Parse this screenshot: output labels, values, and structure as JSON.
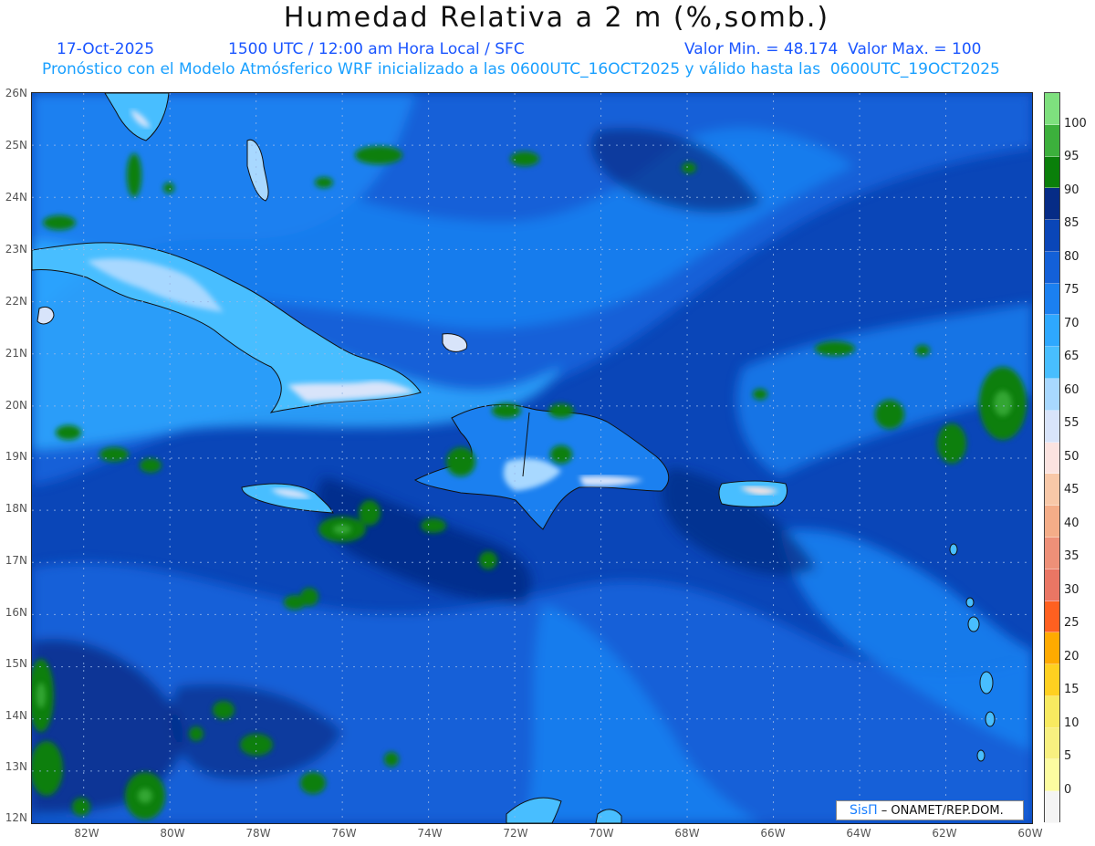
{
  "header": {
    "title": "Humedad Relativa a 2 m (%,somb.)",
    "date": "17-Oct-2025",
    "valid_time": "1500 UTC / 12:00 am Hora Local / SFC",
    "min_max": "Valor Min. = 48.174  Valor Max. = 100",
    "model_info": "Pronóstico con el Modelo Atmósferico WRF inicializado a las 0600UTC_16OCT2025 y válido hasta las  0600UTC_19OCT2025"
  },
  "map": {
    "lat_labels": [
      "26N",
      "25N",
      "24N",
      "23N",
      "22N",
      "21N",
      "20N",
      "19N",
      "18N",
      "17N",
      "16N",
      "15N",
      "14N",
      "13N",
      "12N"
    ],
    "lon_labels": [
      "82W",
      "80W",
      "78W",
      "76W",
      "74W",
      "72W",
      "70W",
      "68W",
      "66W",
      "64W",
      "62W",
      "60W"
    ],
    "lat_range": [
      12,
      26
    ],
    "lon_range": [
      -83.2,
      -60
    ],
    "field_range": [
      48.174,
      100
    ]
  },
  "colorbar": {
    "labels": [
      "100",
      "95",
      "90",
      "85",
      "80",
      "75",
      "70",
      "65",
      "60",
      "55",
      "50",
      "45",
      "40",
      "35",
      "30",
      "25",
      "20",
      "15",
      "10",
      "5",
      "0"
    ],
    "colors": [
      "#7ee07e",
      "#3cb03c",
      "#0a7f0a",
      "#062c86",
      "#0a46b8",
      "#1360d8",
      "#1b80f0",
      "#2ea8ff",
      "#48beff",
      "#a8d8ff",
      "#d8e4fa",
      "#fbe3e0",
      "#f8c8a8",
      "#f4ad88",
      "#ee9078",
      "#ea7664",
      "#ff6020",
      "#ffaa00",
      "#ffd020",
      "#f8ea60",
      "#f8f080",
      "#fcfca0",
      "#f4f4f4"
    ]
  },
  "credit": {
    "logo": "SisΠ",
    "text": "– ONAMET/REP.DOM."
  }
}
